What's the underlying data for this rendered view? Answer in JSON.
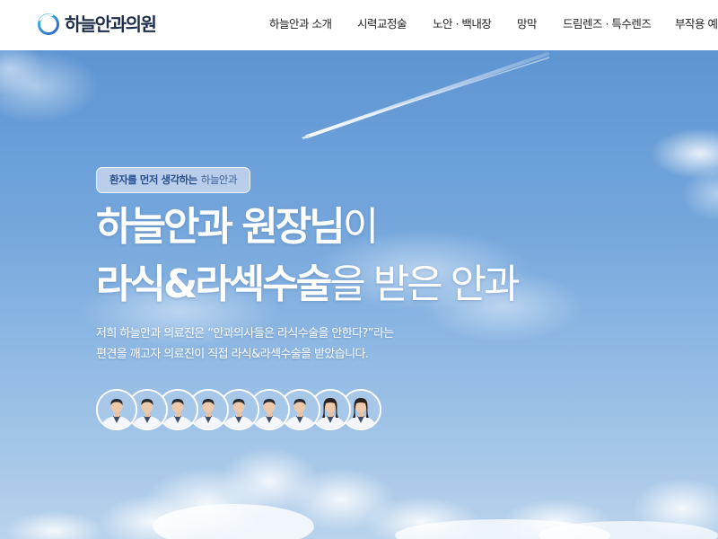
{
  "header": {
    "logo_text": "하늘안과의원",
    "nav": [
      {
        "label": "하늘안과 소개"
      },
      {
        "label": "시력교정술"
      },
      {
        "label": "노안 · 백내장"
      },
      {
        "label": "망막"
      },
      {
        "label": "드림렌즈 · 특수렌즈"
      },
      {
        "label": "부작용 예"
      }
    ]
  },
  "hero": {
    "badge": {
      "strong": "환자를 먼저 생각하는",
      "normal": "하늘안과"
    },
    "headline": {
      "line1_bold": "하늘안과 원장님",
      "line1_light": "이",
      "line2_bold": "라식&라섹수술",
      "line2_light": "을 받은 안과"
    },
    "description": [
      "저희 하늘안과 의료진은 “안과의사들은 라식수술을 안한다?”라는",
      "편견을 깨고자 의료진이 직접 라식&라섹수술을 받았습니다."
    ],
    "doctors": [
      {
        "icon": "doctor-avatar",
        "gender": "male"
      },
      {
        "icon": "doctor-avatar",
        "gender": "male"
      },
      {
        "icon": "doctor-avatar",
        "gender": "male"
      },
      {
        "icon": "doctor-avatar",
        "gender": "male"
      },
      {
        "icon": "doctor-avatar",
        "gender": "male"
      },
      {
        "icon": "doctor-avatar",
        "gender": "male"
      },
      {
        "icon": "doctor-avatar",
        "gender": "male"
      },
      {
        "icon": "doctor-avatar",
        "gender": "female"
      },
      {
        "icon": "doctor-avatar",
        "gender": "female"
      }
    ]
  },
  "colors": {
    "logo_blue": "#2f7fd8",
    "logo_cyan": "#37c1e8",
    "logo_text": "#1c2e4a",
    "sky_top": "#5e95d2",
    "sky_bottom": "#b9d3ec",
    "badge_bg": "#cddaf0",
    "badge_text": "#2c4f8f"
  }
}
